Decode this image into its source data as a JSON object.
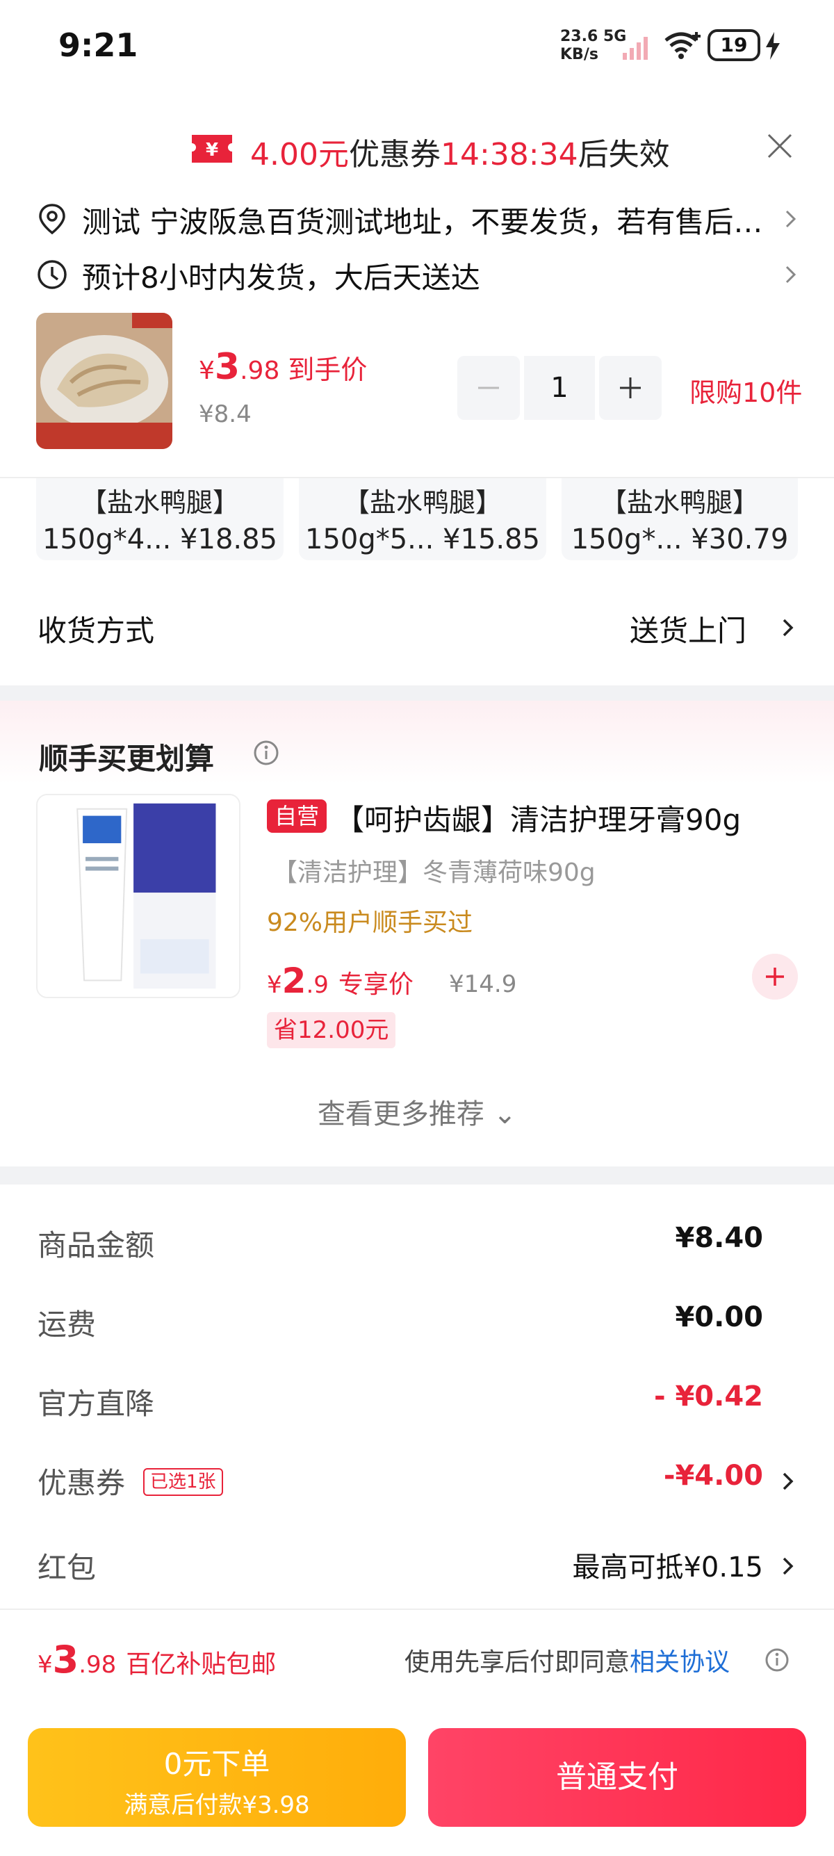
{
  "status_bar": {
    "time": "9:21",
    "net_speed": "23.6",
    "net_unit": "KB/s",
    "net_type": "5G",
    "battery": "19"
  },
  "coupon_banner": {
    "amount": "4.00元",
    "label": "优惠券",
    "countdown": "14:38:34",
    "suffix": "后失效"
  },
  "address": {
    "line": "测试  宁波阪急百货测试地址，不要发货，若有售后请联系",
    "delivery_estimate": "预计8小时内发货，大后天送达"
  },
  "product": {
    "yen": "¥",
    "price_int": "3",
    "price_dec": ".98",
    "price_tag": "到手价",
    "original_price": "¥8.4",
    "quantity": "1",
    "limit": "限购10件"
  },
  "skus": [
    {
      "title": "【盐水鸭腿】",
      "spec": "150g*4...",
      "price": "¥18.85"
    },
    {
      "title": "【盐水鸭腿】",
      "spec": "150g*5...",
      "price": "¥15.85"
    },
    {
      "title": "【盐水鸭腿】",
      "spec": "150g*...",
      "price": "¥30.79"
    }
  ],
  "delivery_method": {
    "label": "收货方式",
    "value": "送货上门"
  },
  "recommend": {
    "title": "顺手买更划算",
    "badge": "自营",
    "name": "【呵护齿龈】清洁护理牙膏90g",
    "spec": "【清洁护理】冬青薄荷味90g",
    "bought": "92%用户顺手买过",
    "yen": "¥",
    "price_int": "2",
    "price_dec": ".9",
    "price_tag": "专享价",
    "original_price": "¥14.9",
    "save": "省12.00元",
    "more": "查看更多推荐 ⌄"
  },
  "summary": {
    "goods_label": "商品金额",
    "goods_value": "¥8.40",
    "shipping_label": "运费",
    "shipping_value": "¥0.00",
    "discount_label": "官方直降",
    "discount_value": "- ¥0.42",
    "coupon_label": "优惠券",
    "coupon_chip": "已选1张",
    "coupon_value": "-¥4.00",
    "redpacket_label": "红包",
    "redpacket_value": "最高可抵¥0.15"
  },
  "footer": {
    "yen": "¥",
    "price_int": "3",
    "price_dec": ".98",
    "price_tag": "百亿补贴包邮",
    "agree_text": "使用先享后付即同意",
    "agree_link": "相关协议",
    "btn_zero_title": "0元下单",
    "btn_zero_sub": "满意后付款¥3.98",
    "btn_pay": "普通支付"
  },
  "colors": {
    "accent_red": "#e8233a",
    "link_blue": "#1e6ed6",
    "gold": "#ffb811"
  }
}
